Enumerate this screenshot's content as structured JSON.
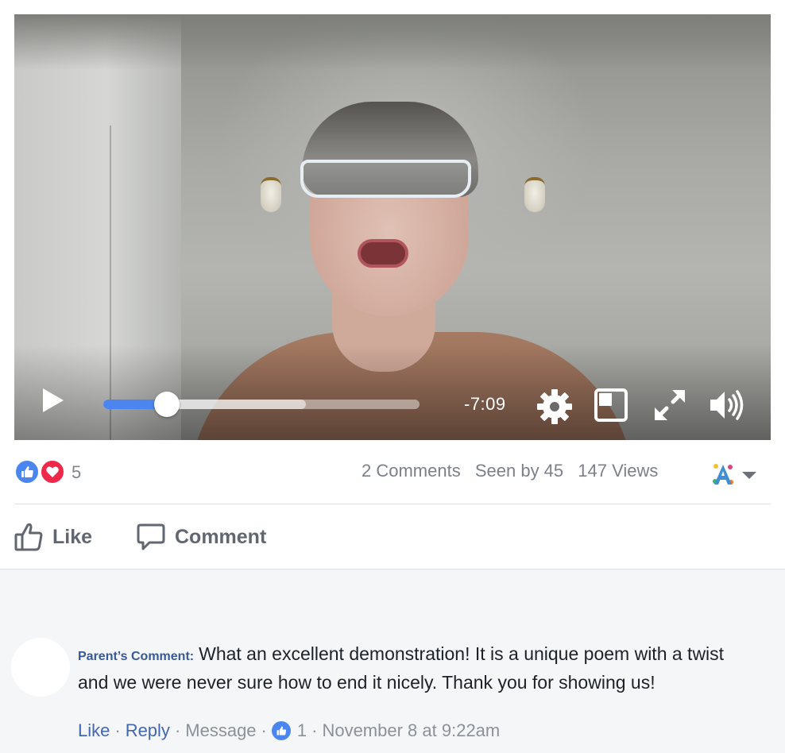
{
  "video": {
    "time_remaining": "-7:09",
    "progress_fraction": 0.2,
    "buffered_fraction": 0.64,
    "controls": [
      "play-icon",
      "gear-icon",
      "picture-in-picture-icon",
      "expand-icon",
      "volume-icon"
    ]
  },
  "stats": {
    "reaction_count": "5",
    "comments": "2 Comments",
    "seen_by": "Seen by 45",
    "views": "147 Views"
  },
  "actions": {
    "like_label": "Like",
    "comment_label": "Comment"
  },
  "comment": {
    "author": "Parent’s Comment:",
    "text": "What an excellent demonstration! It is a unique poem with a twist and we were never sure how to end it nicely. Thank you for showing us!",
    "like_link": "Like",
    "reply_link": "Reply",
    "message_link": "Message",
    "like_count": "1",
    "timestamp": "November 8 at 9:22am"
  },
  "colors": {
    "accent_blue": "#4b86f0",
    "love_red": "#f0284a",
    "link_blue": "#4267b2",
    "muted_text": "#7b818a",
    "comments_bg": "#f5f6f7"
  }
}
